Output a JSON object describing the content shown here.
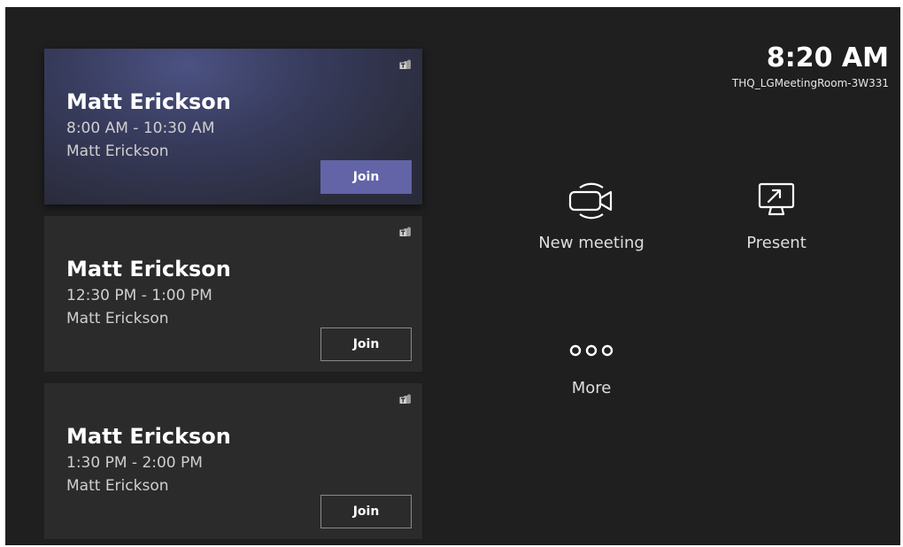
{
  "meetings": [
    {
      "title": "Matt Erickson",
      "time": "8:00 AM - 10:30 AM",
      "organizer": "Matt Erickson",
      "join_label": "Join",
      "active": true
    },
    {
      "title": "Matt Erickson",
      "time": "12:30 PM - 1:00 PM",
      "organizer": "Matt Erickson",
      "join_label": "Join",
      "active": false
    },
    {
      "title": "Matt Erickson",
      "time": "1:30 PM - 2:00 PM",
      "organizer": "Matt Erickson",
      "join_label": "Join",
      "active": false
    }
  ],
  "header": {
    "clock": "8:20 AM",
    "room_name": "THQ_LGMeetingRoom-3W331"
  },
  "actions": {
    "new_meeting": {
      "label": "New meeting",
      "icon": "video-camera-icon"
    },
    "present": {
      "label": "Present",
      "icon": "screen-share-icon"
    },
    "more": {
      "label": "More",
      "icon": "more-icon"
    }
  },
  "colors": {
    "background": "#1f1f1f",
    "card": "#2b2b2b",
    "accent": "#6264a7"
  }
}
